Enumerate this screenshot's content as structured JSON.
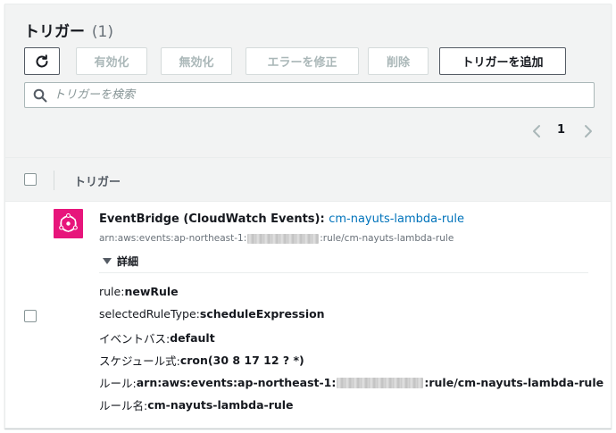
{
  "header": {
    "title": "トリガー",
    "count": "(1)"
  },
  "toolbar": {
    "enable_label": "有効化",
    "disable_label": "無効化",
    "fix_errors_label": "エラーを修正",
    "delete_label": "削除",
    "add_trigger_label": "トリガーを追加"
  },
  "search": {
    "placeholder": "トリガーを検索",
    "value": ""
  },
  "pagination": {
    "current_page": "1"
  },
  "table": {
    "column_header": "トリガー"
  },
  "trigger": {
    "source": "EventBridge (CloudWatch Events)",
    "separator": ":",
    "rule_link": "cm-nayuts-lambda-rule",
    "arn_prefix": "arn:aws:events:ap-northeast-1:",
    "arn_suffix": ":rule/cm-nayuts-lambda-rule",
    "details_label": "詳細",
    "details": {
      "rule_key": "rule: ",
      "rule_value": "newRule",
      "selected_rule_type_key": "selectedRuleType: ",
      "selected_rule_type_value": "scheduleExpression",
      "event_bus_key": "イベントバス: ",
      "event_bus_value": "default",
      "schedule_key": "スケジュール式: ",
      "schedule_value": "cron(30 8 17 12 ? *)",
      "rule_arn_key": "ルール: ",
      "rule_arn_prefix": "arn:aws:events:ap-northeast-1:",
      "rule_arn_suffix": ":rule/cm-nayuts-lambda-rule",
      "rule_name_key": "ルール名: ",
      "rule_name_value": "cm-nayuts-lambda-rule"
    }
  },
  "icons": {
    "refresh": "refresh-icon",
    "search": "search-icon",
    "prev": "chevron-left-icon",
    "next": "chevron-right-icon",
    "eventbridge": "eventbridge-icon",
    "caret": "caret-down-icon"
  },
  "colors": {
    "link": "#0073bb",
    "eventbridge_brand": "#e7157b",
    "header_bg": "#f2f3f3",
    "disabled_text": "#aab7b8"
  }
}
